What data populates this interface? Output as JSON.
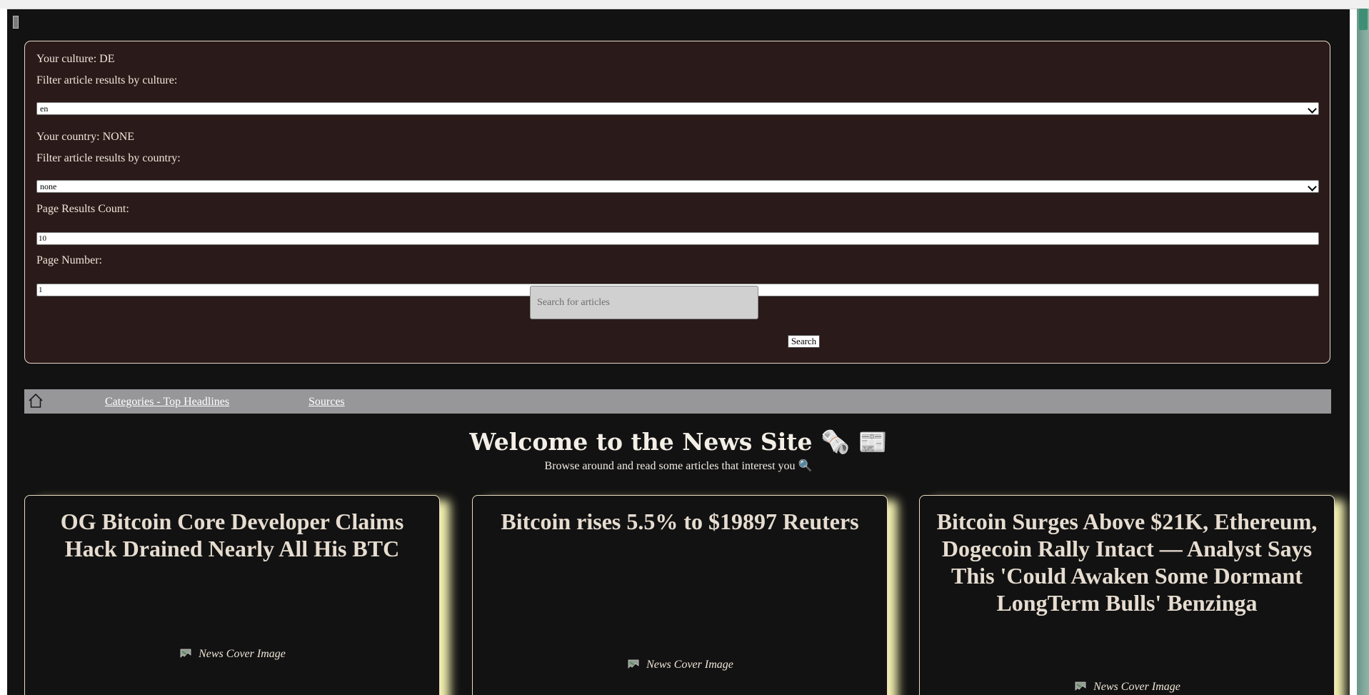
{
  "filters": {
    "culture_label": "Your culture: DE",
    "culture_filter_label": "Filter article results by culture:",
    "culture_selected": "en",
    "country_label": "Your country: NONE",
    "country_filter_label": "Filter article results by country:",
    "country_selected": "none",
    "page_count_label": "Page Results Count:",
    "page_count_value": "10",
    "page_number_label": "Page Number:",
    "page_number_value": "1",
    "search_placeholder": "Search for articles",
    "search_button": "Search"
  },
  "nav": {
    "home_icon": "home-icon",
    "links": [
      "Categories - Top Headlines",
      "Sources"
    ]
  },
  "header": {
    "title": "Welcome to the News Site 🗞️ 📰",
    "subtitle": "Browse around and read some articles that interest you 🔍"
  },
  "articles": [
    {
      "title": "OG Bitcoin Core Developer Claims Hack Drained Nearly All His BTC",
      "image_alt": "News Cover Image"
    },
    {
      "title": "Bitcoin rises 5.5% to $19897 Reuters",
      "image_alt": "News Cover Image"
    },
    {
      "title": "Bitcoin Surges Above $21K, Ethereum, Dogecoin Rally Intact — Analyst Says This 'Could Awaken Some Dormant LongTerm Bulls' Benzinga",
      "image_alt": "News Cover Image"
    }
  ],
  "colors": {
    "page_background": "#121212",
    "panel_background": "#2a1a1a",
    "navbar_background": "#979699",
    "card_glow": "#f2f0b0"
  }
}
